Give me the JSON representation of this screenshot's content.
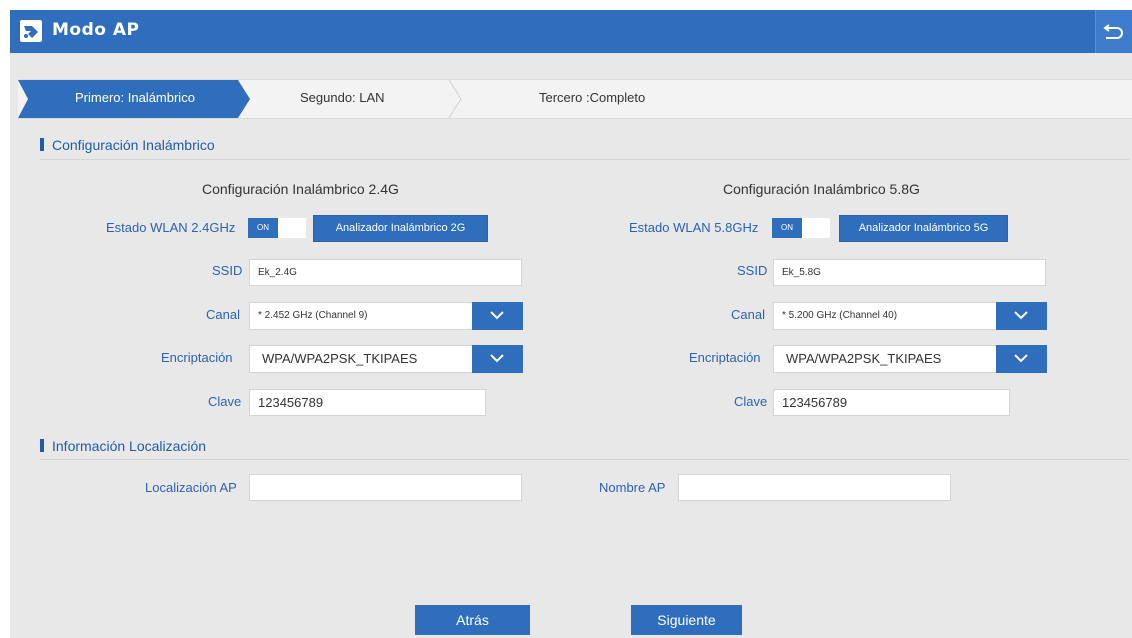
{
  "app": {
    "title": "Modo AP",
    "icon": "router-icon",
    "back_icon": "back-arrow-icon"
  },
  "steps": [
    {
      "label": "Primero: Inalámbrico",
      "active": true
    },
    {
      "label": "Segundo: LAN",
      "active": false
    },
    {
      "label": "Tercero :Completo",
      "active": false
    }
  ],
  "wireless": {
    "heading": "Configuración Inalámbrico",
    "band24": {
      "title": "Configuración Inalámbrico 2.4G",
      "status_label": "Estado WLAN 2.4GHz",
      "toggle": "ON",
      "analyzer_button": "Analizador Inalámbrico 2G",
      "ssid_label": "SSID",
      "ssid_value": "Ek_2.4G",
      "channel_label": "Canal",
      "channel_value": "* 2.452 GHz (Channel 9)",
      "encryption_label": "Encriptación",
      "encryption_value": "WPA/WPA2PSK_TKIPAES",
      "key_label": "Clave",
      "key_value": "123456789"
    },
    "band58": {
      "title": "Configuración Inalámbrico 5.8G",
      "status_label": "Estado WLAN 5.8GHz",
      "toggle": "ON",
      "analyzer_button": "Analizador Inalámbrico 5G",
      "ssid_label": "SSID",
      "ssid_value": "Ek_5.8G",
      "channel_label": "Canal",
      "channel_value": "* 5.200 GHz (Channel 40)",
      "encryption_label": "Encriptación",
      "encryption_value": "WPA/WPA2PSK_TKIPAES",
      "key_label": "Clave",
      "key_value": "123456789"
    }
  },
  "location": {
    "heading": "Información Localización",
    "ap_location_label": "Localización AP",
    "ap_location_value": "",
    "ap_name_label": "Nombre AP",
    "ap_name_value": ""
  },
  "footer": {
    "back_label": "Atrás",
    "next_label": "Siguiente"
  },
  "colors": {
    "accent": "#2f6dbd",
    "label": "#2b62b3",
    "background": "#e8e8e8"
  }
}
